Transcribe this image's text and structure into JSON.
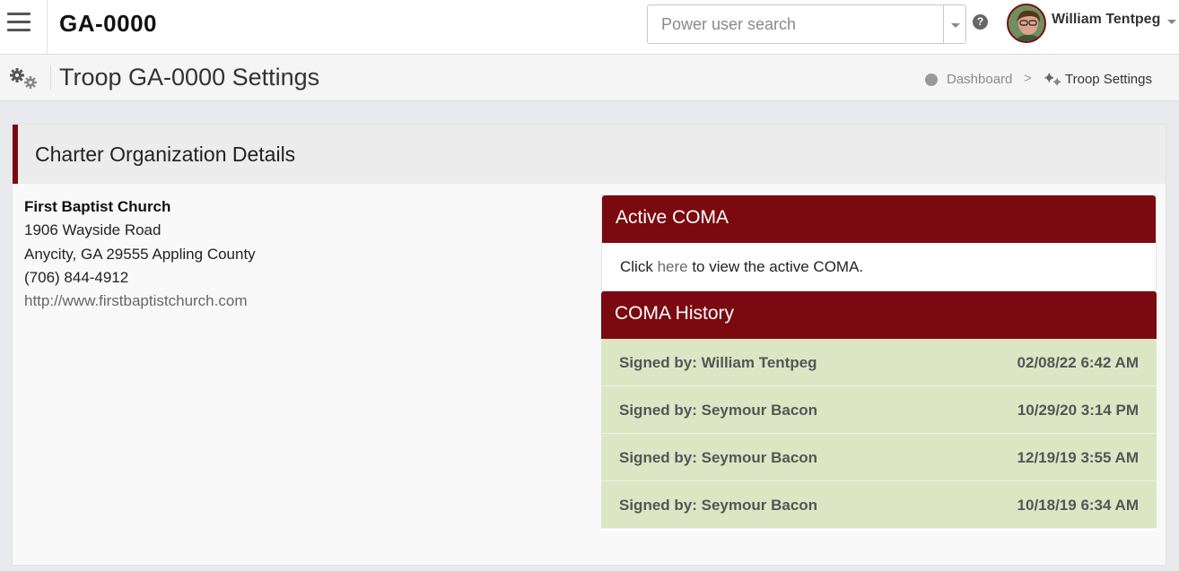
{
  "header": {
    "unit_title": "GA-0000",
    "search_placeholder": "Power user search",
    "help_label": "?",
    "user_name": "William Tentpeg"
  },
  "page": {
    "title": "Troop GA-0000 Settings",
    "breadcrumb": {
      "dashboard": "Dashboard",
      "separator": ">",
      "current": "Troop Settings"
    }
  },
  "card": {
    "title": "Charter Organization Details",
    "org": {
      "name": "First Baptist Church",
      "address1": "1906 Wayside Road",
      "address2": "Anycity, GA 29555 Appling County",
      "phone": "(706) 844-4912",
      "url": "http://www.firstbaptistchurch.com"
    },
    "active_coma": {
      "title": "Active COMA",
      "text_before": "Click ",
      "link": "here",
      "text_after": " to view the active COMA."
    },
    "coma_history": {
      "title": "COMA History",
      "rows": [
        {
          "signed": "Signed by: William Tentpeg",
          "date": "02/08/22 6:42 AM"
        },
        {
          "signed": "Signed by: Seymour Bacon",
          "date": "10/29/20 3:14 PM"
        },
        {
          "signed": "Signed by: Seymour Bacon",
          "date": "12/19/19 3:55 AM"
        },
        {
          "signed": "Signed by: Seymour Bacon",
          "date": "10/18/19 6:34 AM"
        }
      ]
    }
  },
  "colors": {
    "accent": "#7b0a10",
    "history_row": "#dce6c4",
    "background": "#e9eaee"
  },
  "icons": [
    "hamburger-menu-icon",
    "chevron-down-icon",
    "help-icon",
    "gears-icon",
    "dashboard-icon"
  ]
}
